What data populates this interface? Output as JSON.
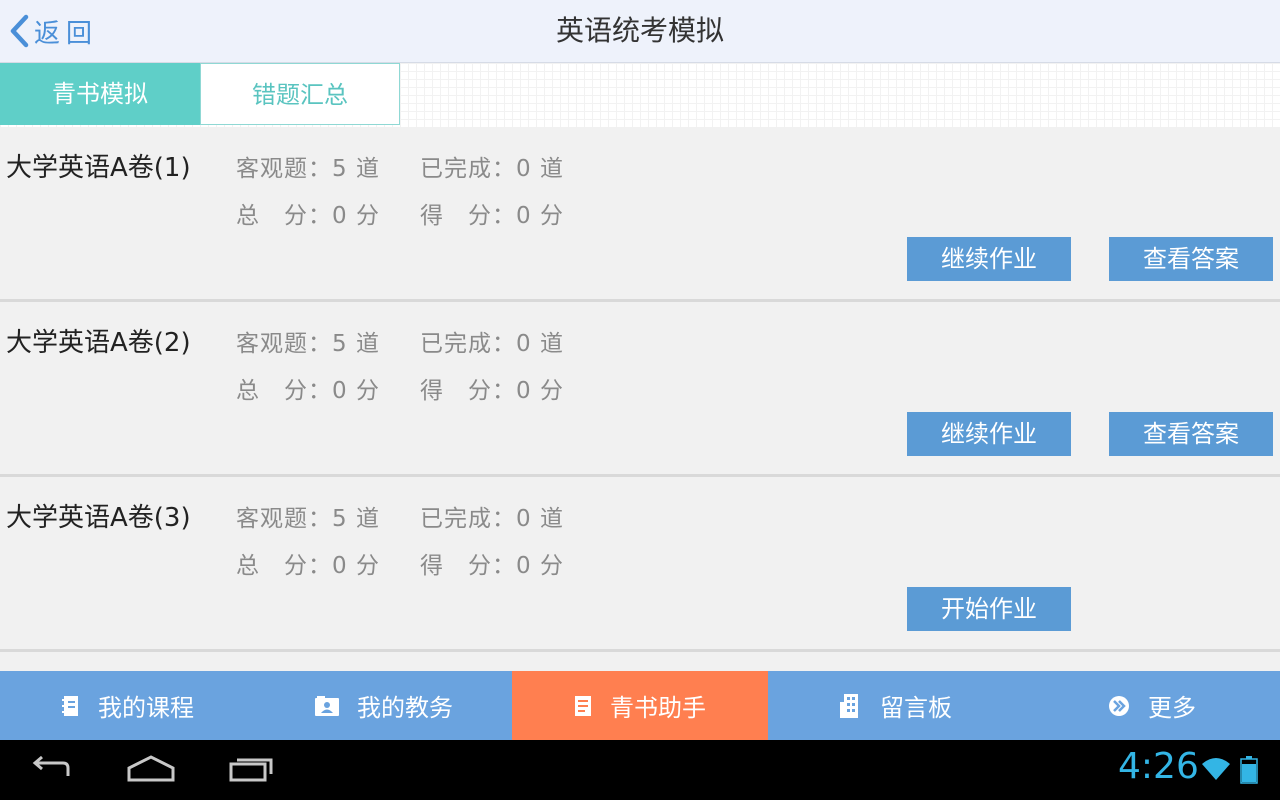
{
  "header": {
    "back_label": "返回",
    "title": "英语统考模拟"
  },
  "tabs": [
    {
      "label": "青书模拟",
      "active": true
    },
    {
      "label": "错题汇总",
      "active": false
    }
  ],
  "exams": [
    {
      "title": "大学英语A卷(1)",
      "objective": "客观题：5 道",
      "completed": "已完成：0 道",
      "total_score": "总　分：0 分",
      "score": "得　分：0 分",
      "buttons": [
        "继续作业",
        "查看答案"
      ]
    },
    {
      "title": "大学英语A卷(2)",
      "objective": "客观题：5 道",
      "completed": "已完成：0 道",
      "total_score": "总　分：0 分",
      "score": "得　分：0 分",
      "buttons": [
        "继续作业",
        "查看答案"
      ]
    },
    {
      "title": "大学英语A卷(3)",
      "objective": "客观题：5 道",
      "completed": "已完成：0 道",
      "total_score": "总　分：0 分",
      "score": "得　分：0 分",
      "buttons": [
        "开始作业"
      ]
    }
  ],
  "bottom_nav": [
    {
      "label": "我的课程",
      "icon": "notebook-icon",
      "active": false
    },
    {
      "label": "我的教务",
      "icon": "user-folder-icon",
      "active": false
    },
    {
      "label": "青书助手",
      "icon": "document-icon",
      "active": true
    },
    {
      "label": "留言板",
      "icon": "building-icon",
      "active": false
    },
    {
      "label": "更多",
      "icon": "double-chevron-icon",
      "active": false
    }
  ],
  "system_bar": {
    "time": "4:26",
    "icons": [
      "back-nav-icon",
      "home-nav-icon",
      "recents-nav-icon",
      "wifi-icon",
      "battery-icon"
    ]
  },
  "colors": {
    "accent_teal": "#5fcfc8",
    "button_blue": "#5b9bd5",
    "nav_blue": "#6aa3df",
    "nav_active": "#ff7f50",
    "clock_blue": "#33b5e5"
  }
}
